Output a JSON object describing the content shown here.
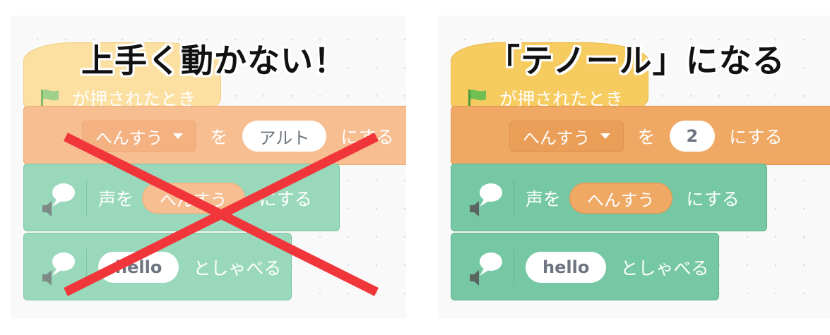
{
  "left_panel": {
    "headline": "上手く動かない！",
    "hat_label": "が押されたとき",
    "set_block": {
      "variable": "へんすう",
      "to_label": "を",
      "value": "アルト",
      "suffix": "にする"
    },
    "voice_block": {
      "label": "声を",
      "value": "へんすう",
      "suffix": "にする"
    },
    "say_block": {
      "value": "hello",
      "suffix": "としゃべる"
    },
    "overlay": "cross-mark",
    "faded": true
  },
  "right_panel": {
    "headline": "「テノール」になる",
    "hat_label": "が押されたとき",
    "set_block": {
      "variable": "へんすう",
      "to_label": "を",
      "value": "2",
      "suffix": "にする"
    },
    "voice_block": {
      "label": "声を",
      "value": "へんすう",
      "suffix": "にする"
    },
    "say_block": {
      "value": "hello",
      "suffix": "としゃべる"
    },
    "faded": false
  },
  "colors": {
    "left": {
      "hat": "#fbe0a2",
      "hat_border": "#f2cf82",
      "set": "#f7be91",
      "set_border": "#efaa76",
      "speech": "#9ad8bc",
      "speech_border": "#7fc6a6",
      "orange_pill": "#f7be91"
    },
    "right": {
      "hat": "#f6cc60",
      "hat_border": "#e9b745",
      "set": "#f0a865",
      "set_border": "#df9350",
      "speech": "#76c8a4",
      "speech_border": "#5cb38d",
      "orange_pill": "#f0a865"
    },
    "cross": "#f0363b",
    "flag": "#6fbf52"
  },
  "icons": [
    "green-flag-icon",
    "speech-bubble-icon",
    "speaker-icon",
    "dropdown-caret-icon"
  ]
}
